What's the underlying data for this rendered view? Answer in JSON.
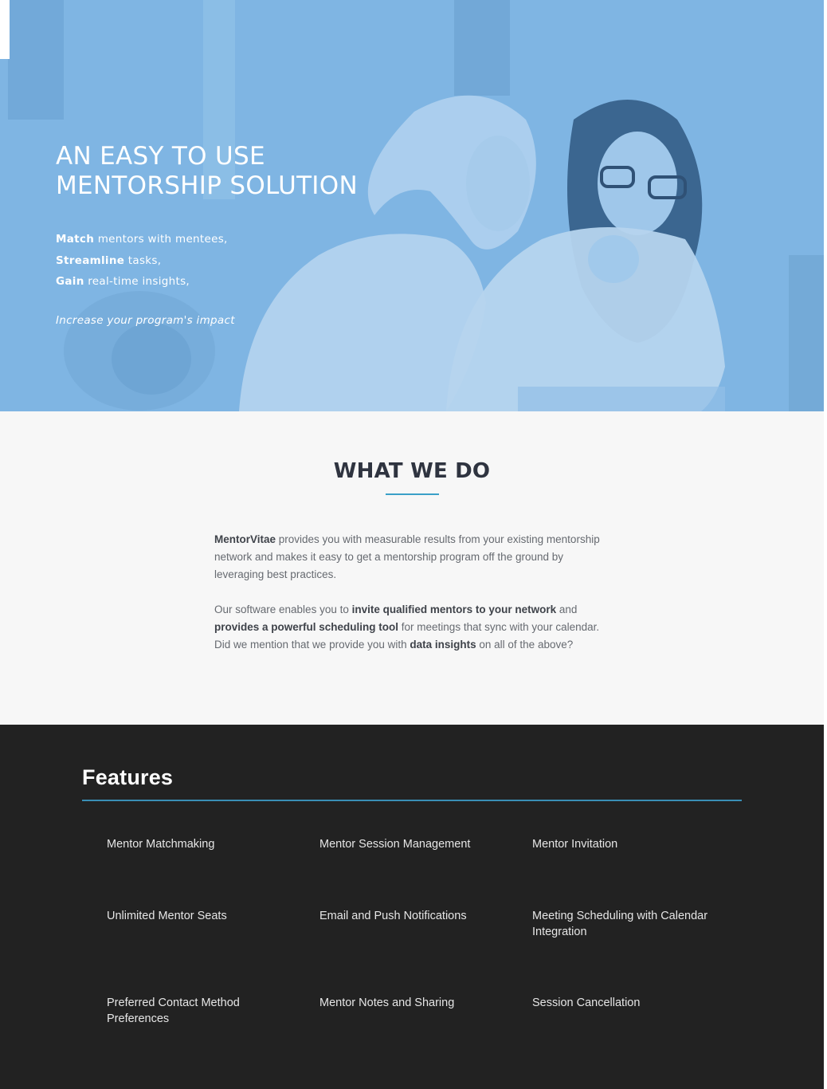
{
  "hero": {
    "title_line1": "AN EASY TO USE",
    "title_line2": "MENTORSHIP SOLUTION",
    "bullets": [
      {
        "bold": "Match",
        "rest": " mentors with mentees,"
      },
      {
        "bold": "Streamline",
        "rest": " tasks,"
      },
      {
        "bold": "Gain",
        "rest": " real-time insights,"
      }
    ],
    "tagline": "Increase your program's impact",
    "overlay_color": "#5ca0dc"
  },
  "what_we_do": {
    "title": "WHAT WE DO",
    "p1": {
      "bold1": "MentorVitae",
      "text1": " provides you with measurable results from your existing mentorship network and makes it easy to get a mentorship program off the ground by leveraging best practices."
    },
    "p2": {
      "text1": "Our software enables you to ",
      "bold1": "invite qualified mentors to your network",
      "text2": " and ",
      "bold2": "provides a powerful scheduling tool",
      "text3": " for meetings that sync with your calendar. Did we mention that we provide you with ",
      "bold3": "data insights",
      "text4": " on all of the above?"
    },
    "accent_color": "#3aa0c8"
  },
  "features": {
    "title": "Features",
    "items": [
      "Mentor Matchmaking",
      "Mentor Session Management",
      "Mentor Invitation",
      "Unlimited Mentor Seats",
      "Email and Push Notifications",
      "Meeting Scheduling with Calendar Integration",
      "Preferred Contact Method Preferences",
      "Mentor Notes and Sharing",
      "Session Cancellation"
    ],
    "background_color": "#222222"
  }
}
